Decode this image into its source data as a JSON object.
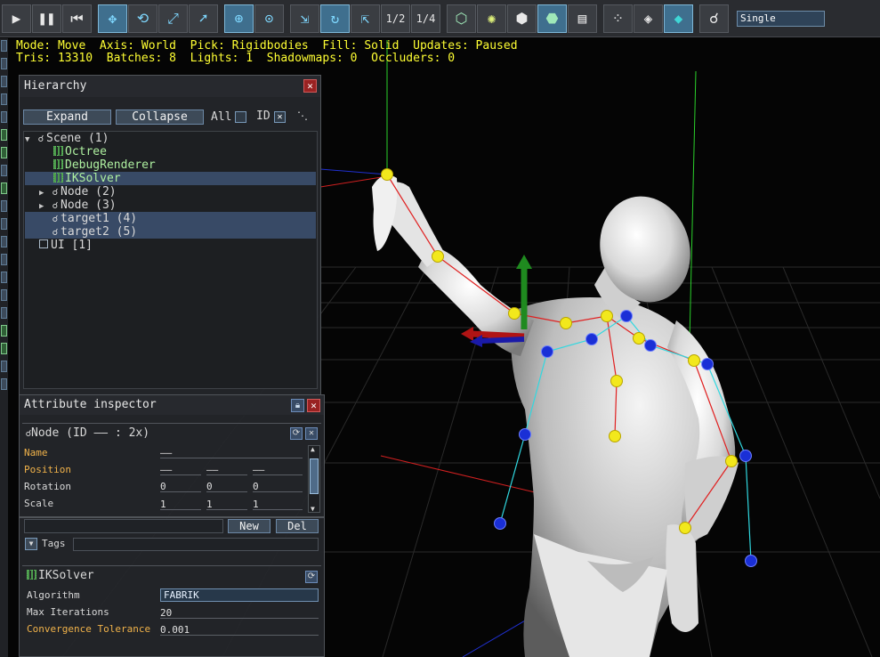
{
  "status": {
    "line1": "Mode: Move  Axis: World  Pick: Rigidbodies  Fill: Solid  Updates: Paused",
    "line2": "Tris: 13310  Batches: 8  Lights: 1  Shadowmaps: 0  Occluders: 0"
  },
  "toolbar": {
    "view_mode": "Single",
    "half_label": "1/2",
    "quarter_label": "1/4"
  },
  "hierarchy": {
    "title": "Hierarchy",
    "expand_label": "Expand",
    "collapse_label": "Collapse",
    "all_label": "All",
    "id_label": "ID",
    "items": [
      {
        "label": "Scene (1)"
      },
      {
        "label": "Octree"
      },
      {
        "label": "DebugRenderer"
      },
      {
        "label": "IKSolver"
      },
      {
        "label": "Node (2)"
      },
      {
        "label": "Node (3)"
      },
      {
        "label": "target1 (4)"
      },
      {
        "label": "target2 (5)"
      },
      {
        "label": "UI [1]"
      }
    ]
  },
  "inspector": {
    "title": "Attribute inspector",
    "node_header": "Node (ID —— : 2x)",
    "name_label": "Name",
    "name_value": "——",
    "position_label": "Position",
    "position_values": [
      "——",
      "——",
      "——"
    ],
    "rotation_label": "Rotation",
    "rotation_values": [
      "0",
      "0",
      "0"
    ],
    "scale_label": "Scale",
    "scale_values": [
      "1",
      "1",
      "1"
    ]
  },
  "lower": {
    "new_label": "New",
    "del_label": "Del",
    "tags_label": "Tags",
    "component_title": "IKSolver",
    "algorithm_label": "Algorithm",
    "algorithm_value": "FABRIK",
    "max_iter_label": "Max Iterations",
    "max_iter_value": "20",
    "conv_label": "Convergence Tolerance",
    "conv_value": "0.001"
  },
  "colors": {
    "status_text": "#ffff33",
    "joint_yellow": "#f2e81c",
    "joint_blue": "#1a2fd6",
    "bone_red": "#e02020",
    "bone_cyan": "#30d8e0",
    "axis_green": "#1f8a1f"
  }
}
